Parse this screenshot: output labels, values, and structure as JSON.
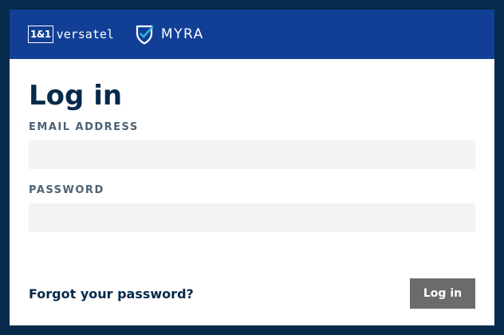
{
  "header": {
    "versatel_logo_box": "1&1",
    "versatel_logo_word": "versatel",
    "myra_logo_word": "MYRA"
  },
  "form": {
    "title": "Log in",
    "email_label": "EMAIL ADDRESS",
    "email_value": "",
    "password_label": "PASSWORD",
    "password_value": "",
    "forgot_link": "Forgot your password?",
    "submit_label": "Log in"
  },
  "colors": {
    "page_background": "#062a4b",
    "header_background": "#123f96",
    "input_background": "#f2f3f4",
    "button_background": "#6b6b6b"
  },
  "icons": {
    "myra_logo": "shield-check-icon"
  }
}
